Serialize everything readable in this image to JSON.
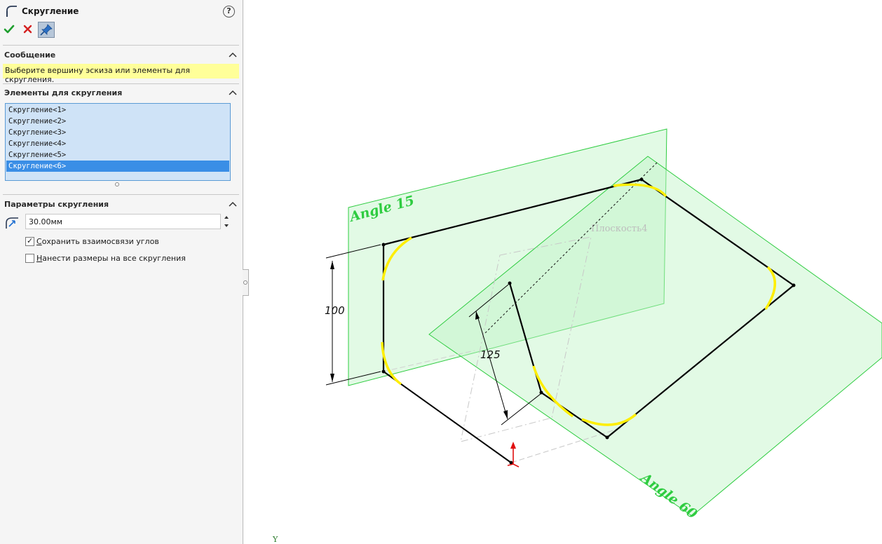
{
  "panel": {
    "title": "Скругление",
    "help_icon": "question-circle-icon",
    "actions": {
      "ok_icon": "checkmark-icon",
      "cancel_icon": "x-icon",
      "pin_icon": "pushpin-icon"
    },
    "message": {
      "title": "Сообщение",
      "text": "Выберите вершину эскиза или элементы для скругления."
    },
    "entities": {
      "title": "Элементы для скругления",
      "items": [
        "Скругление<1>",
        "Скругление<2>",
        "Скругление<3>",
        "Скругление<4>",
        "Скругление<5>",
        "Скругление<6>"
      ],
      "selected_index": 5
    },
    "parameters": {
      "title": "Параметры скругления",
      "radius_value": "30.00мм",
      "keep_constrained_corners": {
        "checked": true,
        "label_underlined": "С",
        "label_rest": "охранить взаимосвязи углов"
      },
      "dimension_each_fillet": {
        "checked": false,
        "label_underlined": "Н",
        "label_rest": "анести размеры на все скругления"
      }
    }
  },
  "viewport": {
    "plane_a_label": "Angle 15",
    "plane_b_label": "Angle 60",
    "plane4_label": "Плоскость4",
    "dim_height": "100",
    "dim_length": "125",
    "axis_label": "Y",
    "colors": {
      "plane_stroke": "#2ecc40",
      "plane_fill": "#bff5c6",
      "fillet": "#ffee00",
      "sketch": "#000000",
      "triad": "#e01010"
    }
  }
}
